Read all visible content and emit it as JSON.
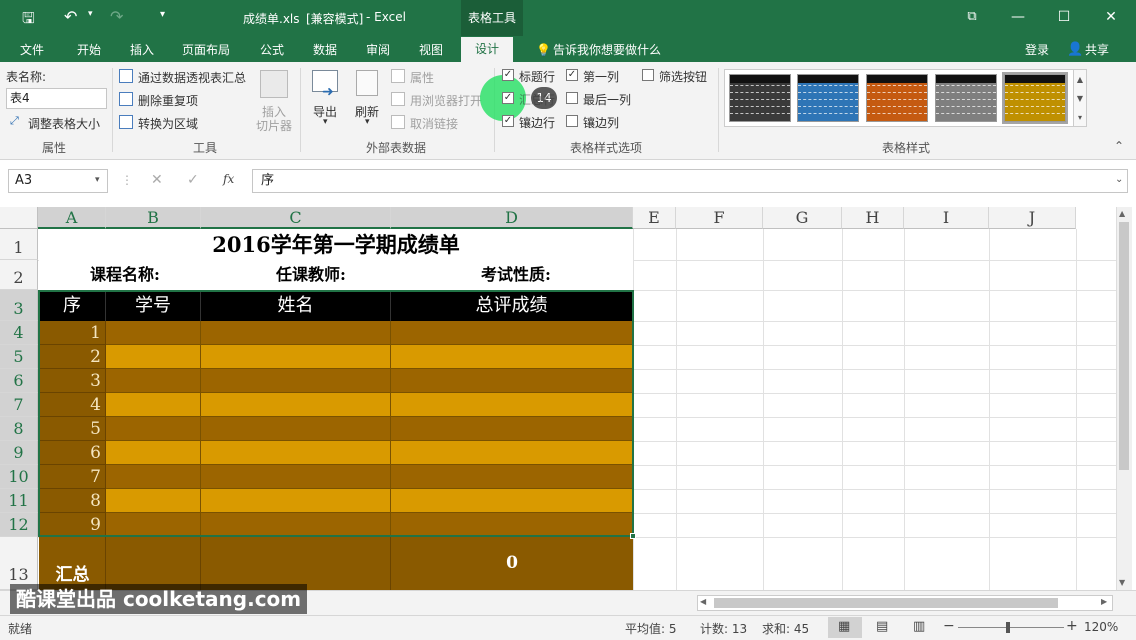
{
  "titlebar": {
    "filename": "成绩单.xls",
    "mode": "[兼容模式]",
    "app": "- Excel",
    "context_tab": "表格工具"
  },
  "tabs": [
    "文件",
    "开始",
    "插入",
    "页面布局",
    "公式",
    "数据",
    "审阅",
    "视图",
    "设计"
  ],
  "active_tab": "设计",
  "tellme": "告诉我你想要做什么",
  "login": "登录",
  "share": "共享",
  "ribbon": {
    "props": {
      "table_name_label": "表名称:",
      "table_name_value": "表4",
      "resize": "调整表格大小",
      "group": "属性"
    },
    "tools": {
      "pivot": "通过数据透视表汇总",
      "dedupe": "删除重复项",
      "convert": "转换为区域",
      "slicer_line1": "插入",
      "slicer_line2": "切片器",
      "group": "工具"
    },
    "external": {
      "export": "导出",
      "refresh": "刷新",
      "properties": "属性",
      "browser": "用浏览器打开",
      "unlink": "取消链接",
      "group": "外部表数据"
    },
    "options": {
      "header_row": "标题行",
      "total_row": "汇总行",
      "banded_rows": "镶边行",
      "first_col": "第一列",
      "last_col": "最后一列",
      "banded_cols": "镶边列",
      "filter_btn": "筛选按钮",
      "group": "表格样式选项",
      "tooltip_num": "14"
    },
    "styles": {
      "group": "表格样式",
      "swatch_colors": [
        "#3a3a3a",
        "#2e75b6",
        "#c55a11",
        "#7f7f7f",
        "#bf9000"
      ]
    }
  },
  "formula": {
    "namebox": "A3",
    "fx": "fx",
    "content": "序"
  },
  "columns": [
    "A",
    "B",
    "C",
    "D",
    "E",
    "F",
    "G",
    "H",
    "I",
    "J"
  ],
  "rows": [
    "1",
    "2",
    "3",
    "4",
    "5",
    "6",
    "7",
    "8",
    "9",
    "10",
    "11",
    "12",
    "13"
  ],
  "sheet": {
    "title": "2016学年第一学期成绩单",
    "course_label": "课程名称:",
    "teacher_label": "任课教师:",
    "exam_label": "考试性质:",
    "headers": [
      "序",
      "学号",
      "姓名",
      "总评成绩"
    ],
    "serials": [
      "1",
      "2",
      "3",
      "4",
      "5",
      "6",
      "7",
      "8",
      "9"
    ],
    "total_label": "汇总",
    "total_value": "0"
  },
  "colors": {
    "excel_green": "#217346",
    "header_black": "#000000",
    "band_dark": "#9c6500",
    "band_light": "#d99a00",
    "first_col": "#8a5a00"
  },
  "status": {
    "ready": "就绪",
    "average": "平均值: 5",
    "count": "计数: 13",
    "sum": "求和: 45",
    "zoom": "120%"
  },
  "watermark": "酷课堂出品 coolketang.com"
}
